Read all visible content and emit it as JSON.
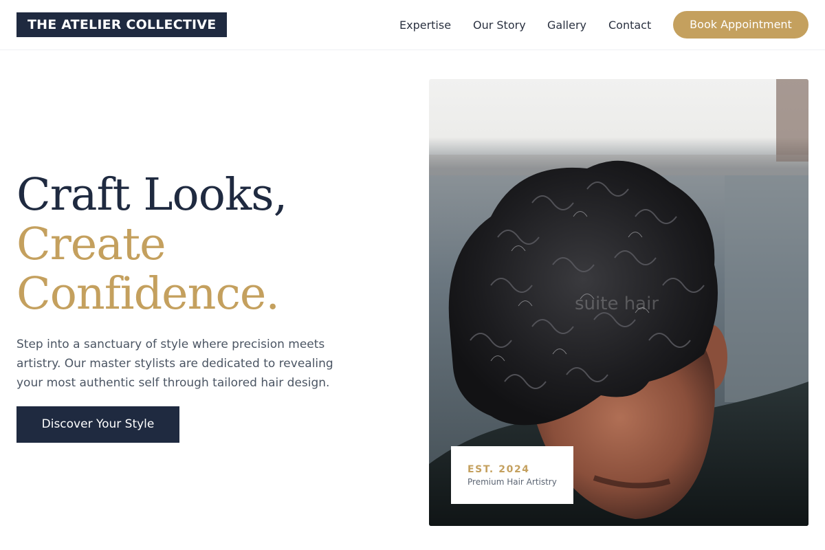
{
  "header": {
    "logo_text": "THE ATELIER COLLECTIVE",
    "nav": {
      "expertise": "Expertise",
      "our_story": "Our Story",
      "gallery": "Gallery",
      "contact": "Contact"
    },
    "book_label": "Book Appointment"
  },
  "hero": {
    "headline_line1": "Craft Looks,",
    "headline_line2": "Create",
    "headline_line3": "Confidence.",
    "description": "Step into a sanctuary of style where precision meets artistry. Our master stylists are dedicated to revealing your most authentic self through tailored hair design.",
    "cta_label": "Discover Your Style",
    "image_watermark": "suite hair",
    "badge": {
      "established": "EST. 2024",
      "subtitle": "Premium Hair Artistry"
    }
  },
  "colors": {
    "navy": "#1f2a40",
    "gold": "#c4a05e",
    "body_text": "#4b5563"
  }
}
